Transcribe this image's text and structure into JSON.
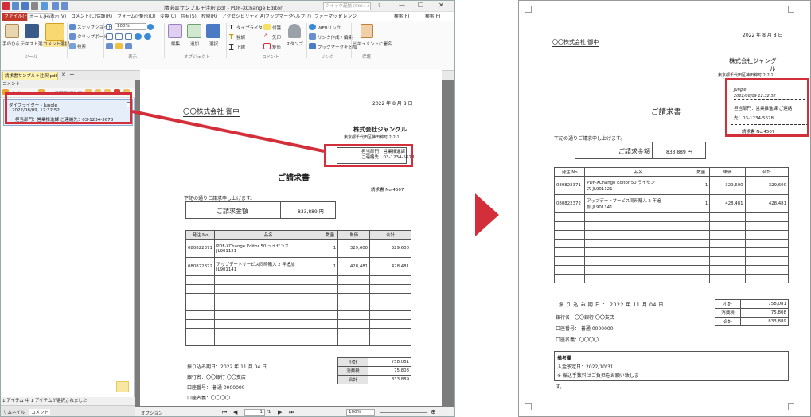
{
  "app": {
    "title": "請求書サンプル＋注釈.pdf - PDF-XChange Editor",
    "quick_search": "クイック起動 (Ctrl+.)",
    "search": "検索",
    "search_key": "(F)",
    "search2": "検索",
    "search2_key": "(F)",
    "menus": [
      "ファイル(F)",
      "ホーム(H)",
      "表示(V)",
      "コメント(C)",
      "保護(R)",
      "フォーム(F)",
      "整形(D)",
      "変換(C)",
      "共有(S)",
      "校閲(R)",
      "アクセシビリティ(A)",
      "ブックマーク",
      "ヘルプ(?)",
      "フォーマット",
      "アレンジ"
    ],
    "ribbon": {
      "hand": "手のひら",
      "text_select": "テキスト選択",
      "comment_select": "コメント選択",
      "snapshot": "スナップショット",
      "clipboard": "クリップボード",
      "find": "検索",
      "zoom": "100%",
      "edit": "編集",
      "add": "追加",
      "select": "選択",
      "typewriter": "タイプライター",
      "highlight": "強調",
      "underline": "下線",
      "strike": "取消",
      "sticky": "付箋",
      "arrow": "矢印",
      "rect": "矩形",
      "stamp": "スタンプ",
      "web_link": "WEBリンク",
      "link_edit": "リンク作成 / 編集",
      "bookmark_add": "ブックマークを追加",
      "doc_add": "ドキュメントに署名",
      "groups": [
        "ツール",
        "表示",
        "オブジェクト",
        "コメント",
        "リンク",
        "保護"
      ]
    },
    "doc_tab": "請求書サンプル＋注釈.pdf",
    "left_header": "コメント",
    "left_tools": {
      "options": "オプション",
      "expand": "すべて展開/折り畳む"
    },
    "comment": {
      "author": "タイプライター - Jungle",
      "date": "2022/08/09, 12:32:52",
      "text": "担当部門：営業推進課 ご連絡先：03-1234-5678"
    },
    "status_left": "1 アイテム 中 1 アイテムが選択されました",
    "bottom_tabs": [
      "サムネイル",
      "コメント"
    ],
    "pagebar": {
      "options": "オプション",
      "page": "1",
      "page_total": "/1",
      "zoom": "100%"
    }
  },
  "invoice": {
    "date": "2022 年 8 月 8 日",
    "to": "〇〇株式会社 御中",
    "company": "株式会社ジャングル",
    "company_r": "株式会社ジャング",
    "company_r2": "ル",
    "address": "東京都千代田区神田錦町 2-2-1",
    "address_r": "東京都千代田区神田錦町 2-2-1",
    "annot_line1": "担当部門：営業推進課",
    "annot_line2": "ご連絡先：03-1234-5678",
    "annot_head": "Jungle",
    "annot_date": "2022/08/09 12:32:52",
    "annot_r1": "担当部門：営業推進課 ご連絡",
    "annot_r2": "先：03-1234-5678",
    "title": "ご請求書",
    "number": "請求書 No.4507",
    "intro": "下記の通りご請求申し上げます。",
    "amount_label": "ご請求金額",
    "amount": "833,889 円",
    "amount_r": "833,889 円",
    "headers": [
      "発注 No",
      "品名",
      "数量",
      "単価",
      "合計"
    ],
    "rows": [
      {
        "no": "080822371",
        "name1": "PDF-XChange Editor 50 ライセンス",
        "name2": "JL901121",
        "qty": "1",
        "price": "329,600",
        "total": "329,600"
      },
      {
        "no": "080822372",
        "name1": "アップデートサービス同時購入 2 年追加",
        "name2": "JL901141",
        "qty": "1",
        "price": "428,481",
        "total": "428,481"
      }
    ],
    "rows_r": [
      {
        "no": "080822371",
        "name1": "PDF-XChange Editor 50 ライセン",
        "name2": "ス JL901121",
        "qty": "1",
        "price": "329,600",
        "total": "329,600"
      },
      {
        "no": "080822372",
        "name1": "アップデートサービス同時購入 2 年追",
        "name2": "加 JL901141",
        "qty": "1",
        "price": "428,481",
        "total": "428,481"
      }
    ],
    "due": "振り込み期日：2022 年 11 月 04 日",
    "due_r": "振 り 込 み 期 日 ： 2022 年 11 月 04 日",
    "bank": "銀行名：〇〇銀行 〇〇支店",
    "account": "口座番号： 普通 0000000",
    "holder": "口座名義：〇〇〇〇",
    "subtotal_label": "小計",
    "subtotal": "758,081",
    "tax_label": "消費税",
    "tax": "75,808",
    "total_label": "合計",
    "total": "833,889",
    "note_head": "備考欄",
    "note1": "入金予定日：2022/10/31",
    "note2": "※ 振込手数料はご負担をお願い致しま",
    "note3": "す。"
  }
}
